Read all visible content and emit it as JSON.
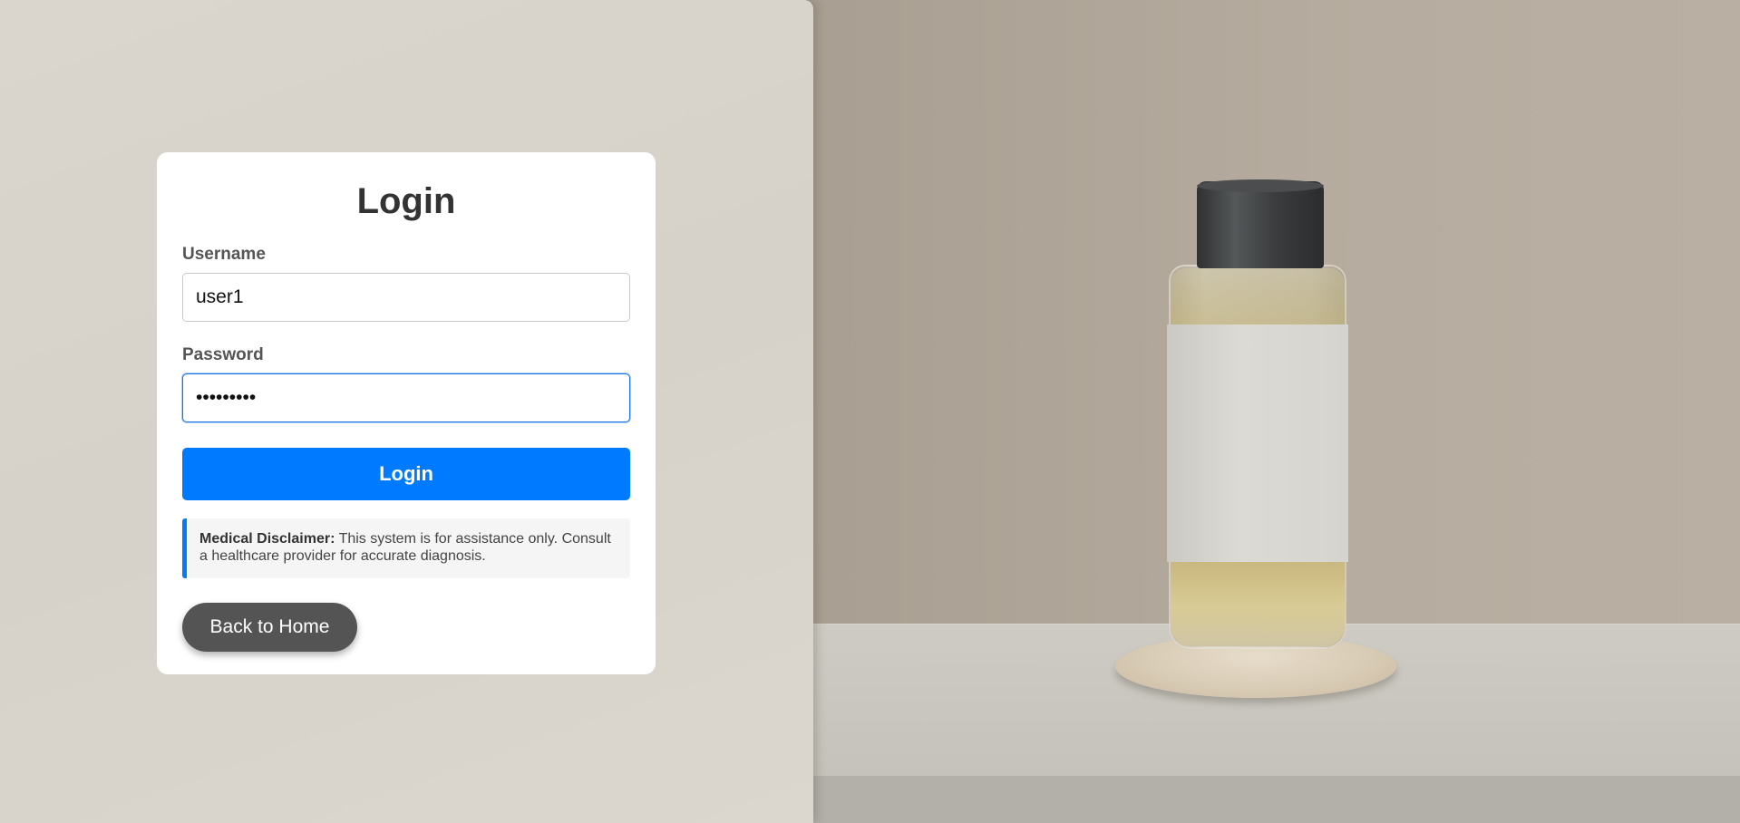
{
  "login": {
    "title": "Login",
    "username_label": "Username",
    "username_value": "user1",
    "password_label": "Password",
    "password_value": "password1",
    "submit_label": "Login"
  },
  "disclaimer": {
    "heading": "Medical Disclaimer:",
    "text": "This system is for assistance only. Consult a healthcare provider for accurate diagnosis."
  },
  "nav": {
    "back_home_label": "Back to Home"
  },
  "colors": {
    "primary": "#007bff",
    "secondary_button": "#545454",
    "title_text": "#333333"
  },
  "icons": {
    "background_photo": "perfume-bottle-photo"
  }
}
